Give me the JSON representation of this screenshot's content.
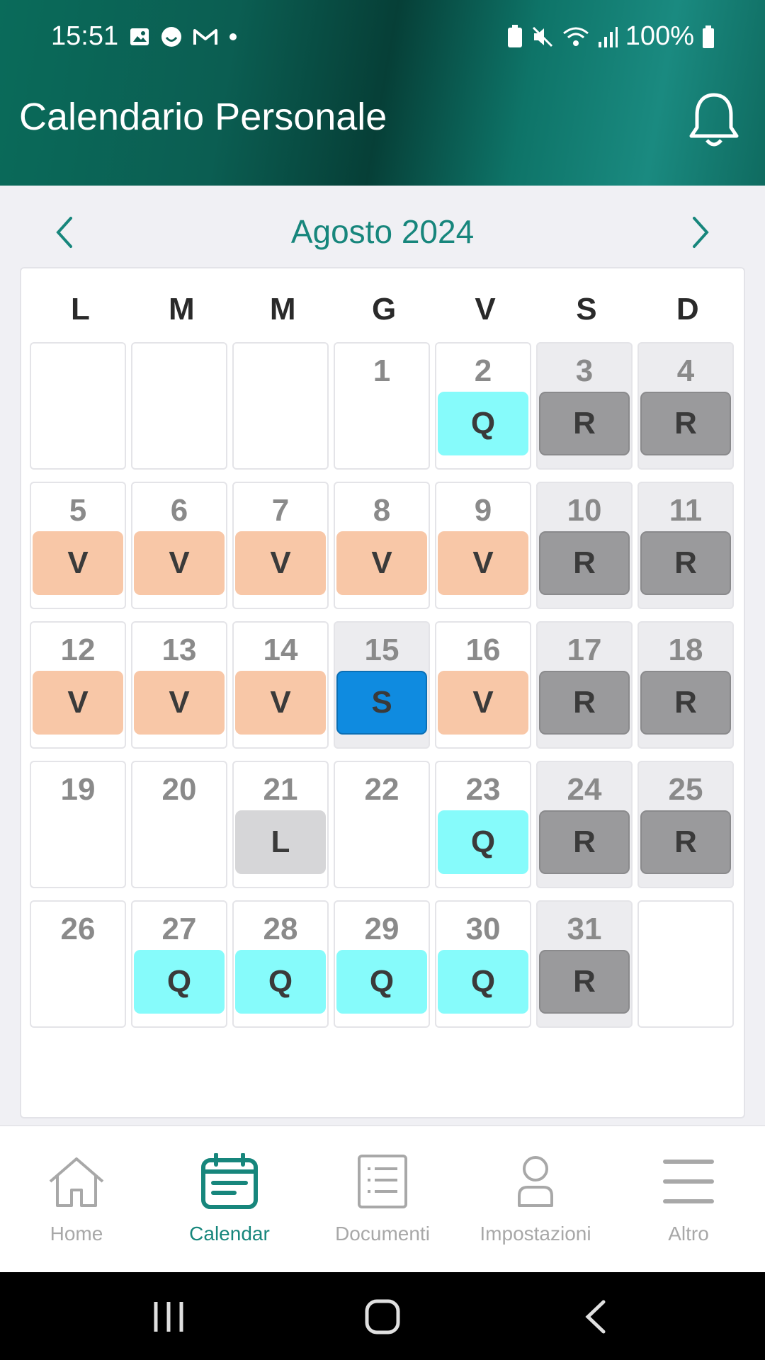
{
  "status_bar": {
    "time": "15:51",
    "battery": "100%"
  },
  "header": {
    "title": "Calendario Personale"
  },
  "calendar": {
    "month_label": "Agosto 2024",
    "weekdays": [
      "L",
      "M",
      "M",
      "G",
      "V",
      "S",
      "D"
    ],
    "weeks": [
      [
        {
          "day": "",
          "tag": ""
        },
        {
          "day": "",
          "tag": ""
        },
        {
          "day": "",
          "tag": ""
        },
        {
          "day": "1",
          "tag": ""
        },
        {
          "day": "2",
          "tag": "Q"
        },
        {
          "day": "3",
          "tag": "R",
          "weekend": true
        },
        {
          "day": "4",
          "tag": "R",
          "weekend": true
        }
      ],
      [
        {
          "day": "5",
          "tag": "V"
        },
        {
          "day": "6",
          "tag": "V"
        },
        {
          "day": "7",
          "tag": "V"
        },
        {
          "day": "8",
          "tag": "V"
        },
        {
          "day": "9",
          "tag": "V"
        },
        {
          "day": "10",
          "tag": "R",
          "weekend": true
        },
        {
          "day": "11",
          "tag": "R",
          "weekend": true
        }
      ],
      [
        {
          "day": "12",
          "tag": "V"
        },
        {
          "day": "13",
          "tag": "V"
        },
        {
          "day": "14",
          "tag": "V"
        },
        {
          "day": "15",
          "tag": "S",
          "weekend": true
        },
        {
          "day": "16",
          "tag": "V"
        },
        {
          "day": "17",
          "tag": "R",
          "weekend": true
        },
        {
          "day": "18",
          "tag": "R",
          "weekend": true
        }
      ],
      [
        {
          "day": "19",
          "tag": ""
        },
        {
          "day": "20",
          "tag": ""
        },
        {
          "day": "21",
          "tag": "L"
        },
        {
          "day": "22",
          "tag": ""
        },
        {
          "day": "23",
          "tag": "Q"
        },
        {
          "day": "24",
          "tag": "R",
          "weekend": true
        },
        {
          "day": "25",
          "tag": "R",
          "weekend": true
        }
      ],
      [
        {
          "day": "26",
          "tag": ""
        },
        {
          "day": "27",
          "tag": "Q"
        },
        {
          "day": "28",
          "tag": "Q"
        },
        {
          "day": "29",
          "tag": "Q"
        },
        {
          "day": "30",
          "tag": "Q"
        },
        {
          "day": "31",
          "tag": "R",
          "weekend": true
        },
        {
          "day": "",
          "tag": ""
        }
      ]
    ]
  },
  "bottom_nav": {
    "items": [
      {
        "label": "Home",
        "icon": "home-icon",
        "active": false
      },
      {
        "label": "Calendar",
        "icon": "calendar-icon",
        "active": true
      },
      {
        "label": "Documenti",
        "icon": "documents-icon",
        "active": false
      },
      {
        "label": "Impostazioni",
        "icon": "user-icon",
        "active": false
      },
      {
        "label": "Altro",
        "icon": "menu-icon",
        "active": false
      }
    ]
  },
  "colors": {
    "accent": "#17867c",
    "tag_Q": "#86fbfb",
    "tag_R": "#9a9a9c",
    "tag_V": "#f8c7a7",
    "tag_L": "#d6d6d8",
    "tag_S": "#0f8be0"
  }
}
